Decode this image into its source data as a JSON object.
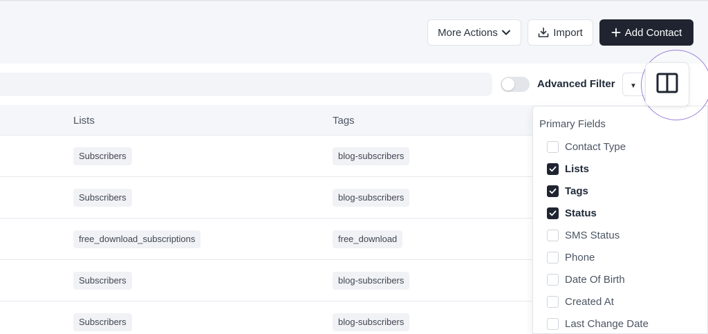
{
  "header": {
    "more_actions_label": "More Actions",
    "import_label": "Import",
    "add_contact_label": "Add Contact"
  },
  "filter": {
    "advanced_filter_label": "Advanced Filter",
    "advanced_filter_enabled": false
  },
  "table": {
    "columns": [
      "Lists",
      "Tags"
    ],
    "rows": [
      {
        "list": "Subscribers",
        "tag": "blog-subscribers"
      },
      {
        "list": "Subscribers",
        "tag": "blog-subscribers"
      },
      {
        "list": "free_download_subscriptions",
        "tag": "free_download"
      },
      {
        "list": "Subscribers",
        "tag": "blog-subscribers"
      },
      {
        "list": "Subscribers",
        "tag": "blog-subscribers"
      }
    ]
  },
  "column_chooser": {
    "section_title": "Primary Fields",
    "options": [
      {
        "label": "Contact Type",
        "checked": false
      },
      {
        "label": "Lists",
        "checked": true
      },
      {
        "label": "Tags",
        "checked": true
      },
      {
        "label": "Status",
        "checked": true
      },
      {
        "label": "SMS Status",
        "checked": false
      },
      {
        "label": "Phone",
        "checked": false
      },
      {
        "label": "Date Of Birth",
        "checked": false
      },
      {
        "label": "Created At",
        "checked": false
      },
      {
        "label": "Last Change Date",
        "checked": false
      }
    ]
  },
  "icons": {
    "chevron": "chevron-down-icon",
    "import": "download-icon",
    "add": "plus-icon",
    "columns": "columns-icon",
    "check": "check-icon"
  },
  "colors": {
    "primary_dark": "#1f2430",
    "highlight_ring": "#9b7fd8"
  }
}
